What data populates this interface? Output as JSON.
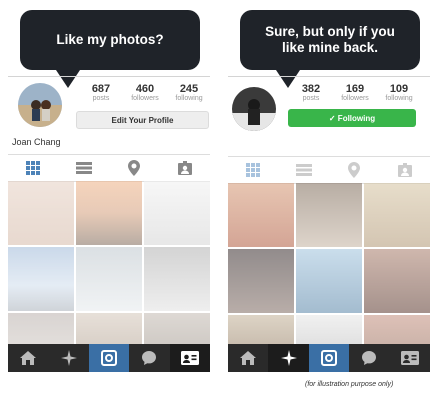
{
  "left": {
    "bubble": "Like my photos?",
    "stats": [
      {
        "count": "687",
        "label": "posts"
      },
      {
        "count": "460",
        "label": "followers"
      },
      {
        "count": "245",
        "label": "following"
      }
    ],
    "edit_button": "Edit Your Profile",
    "username": "Joan Chang"
  },
  "right": {
    "bubble": "Sure, but only if you like mine back.",
    "stats": [
      {
        "count": "382",
        "label": "posts"
      },
      {
        "count": "169",
        "label": "followers"
      },
      {
        "count": "109",
        "label": "following"
      }
    ],
    "follow_button": "✓ Following"
  },
  "tabs": [
    "grid-icon",
    "list-icon",
    "location-icon",
    "tagged-icon"
  ],
  "bottom_nav": [
    "home-icon",
    "explore-icon",
    "camera-icon",
    "activity-icon",
    "profile-icon"
  ],
  "colors": {
    "bubble": "#1f2329",
    "following": "#39b54a",
    "nav_bar": "#2a2a2a",
    "camera": "#3a6fa5"
  },
  "footnote": "(for illustration purpose only)"
}
